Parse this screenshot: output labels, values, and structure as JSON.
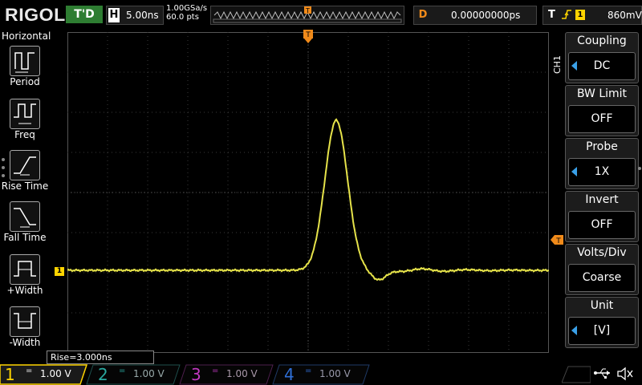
{
  "header": {
    "brand": "RIGOL",
    "run_status": "T'D",
    "horizontal_key": "H",
    "timebase": "5.00ns",
    "sample_rate": "1.00GSa/s",
    "memory_depth": "60.0 pts",
    "delay_key": "D",
    "delay_value": "0.00000000ps",
    "trigger_key": "T",
    "trigger_edge": "rising-edge-icon",
    "trigger_channel": "1",
    "trigger_level": "860mV"
  },
  "left_menu": {
    "title": "Horizontal",
    "items": [
      {
        "label": "Period",
        "icon": "period-icon"
      },
      {
        "label": "Freq",
        "icon": "frequency-icon"
      },
      {
        "label": "Rise Time",
        "icon": "rise-time-icon"
      },
      {
        "label": "Fall Time",
        "icon": "fall-time-icon"
      },
      {
        "label": "+Width",
        "icon": "positive-width-icon"
      },
      {
        "label": "-Width",
        "icon": "negative-width-icon"
      }
    ]
  },
  "right_menu": {
    "channel_tab": "CH1",
    "items": [
      {
        "title": "Coupling",
        "value": "DC",
        "has_arrow": true
      },
      {
        "title": "BW Limit",
        "value": "OFF",
        "has_arrow": false
      },
      {
        "title": "Probe",
        "value": "1X",
        "has_arrow": true
      },
      {
        "title": "Invert",
        "value": "OFF",
        "has_arrow": false
      },
      {
        "title": "Volts/Div",
        "value": "Coarse",
        "has_arrow": false
      },
      {
        "title": "Unit",
        "value": "[V]",
        "has_arrow": true
      }
    ]
  },
  "waveform": {
    "trace_color": "#e6e34a",
    "channel_marker": "1",
    "trigger_marker": "T"
  },
  "measurement": {
    "text": "Rise=3.000ns"
  },
  "channels": [
    {
      "number": "1",
      "coupling": "=",
      "scale": "1.00 V",
      "color": "#ffd400",
      "active": true
    },
    {
      "number": "2",
      "coupling": "=",
      "scale": "1.00 V",
      "color": "#2aa9a0",
      "active": false
    },
    {
      "number": "3",
      "coupling": "=",
      "scale": "1.00 V",
      "color": "#c039c0",
      "active": false
    },
    {
      "number": "4",
      "coupling": "=",
      "scale": "1.00 V",
      "color": "#2f6fd6",
      "active": false
    }
  ],
  "status_icons": {
    "usb": "usb-icon",
    "sound": "speaker-muted-icon"
  },
  "colors": {
    "accent_yellow": "#ffd400",
    "accent_orange": "#f08a1a",
    "run_green": "#2e7d32",
    "menu_blue": "#3aa0e8"
  }
}
